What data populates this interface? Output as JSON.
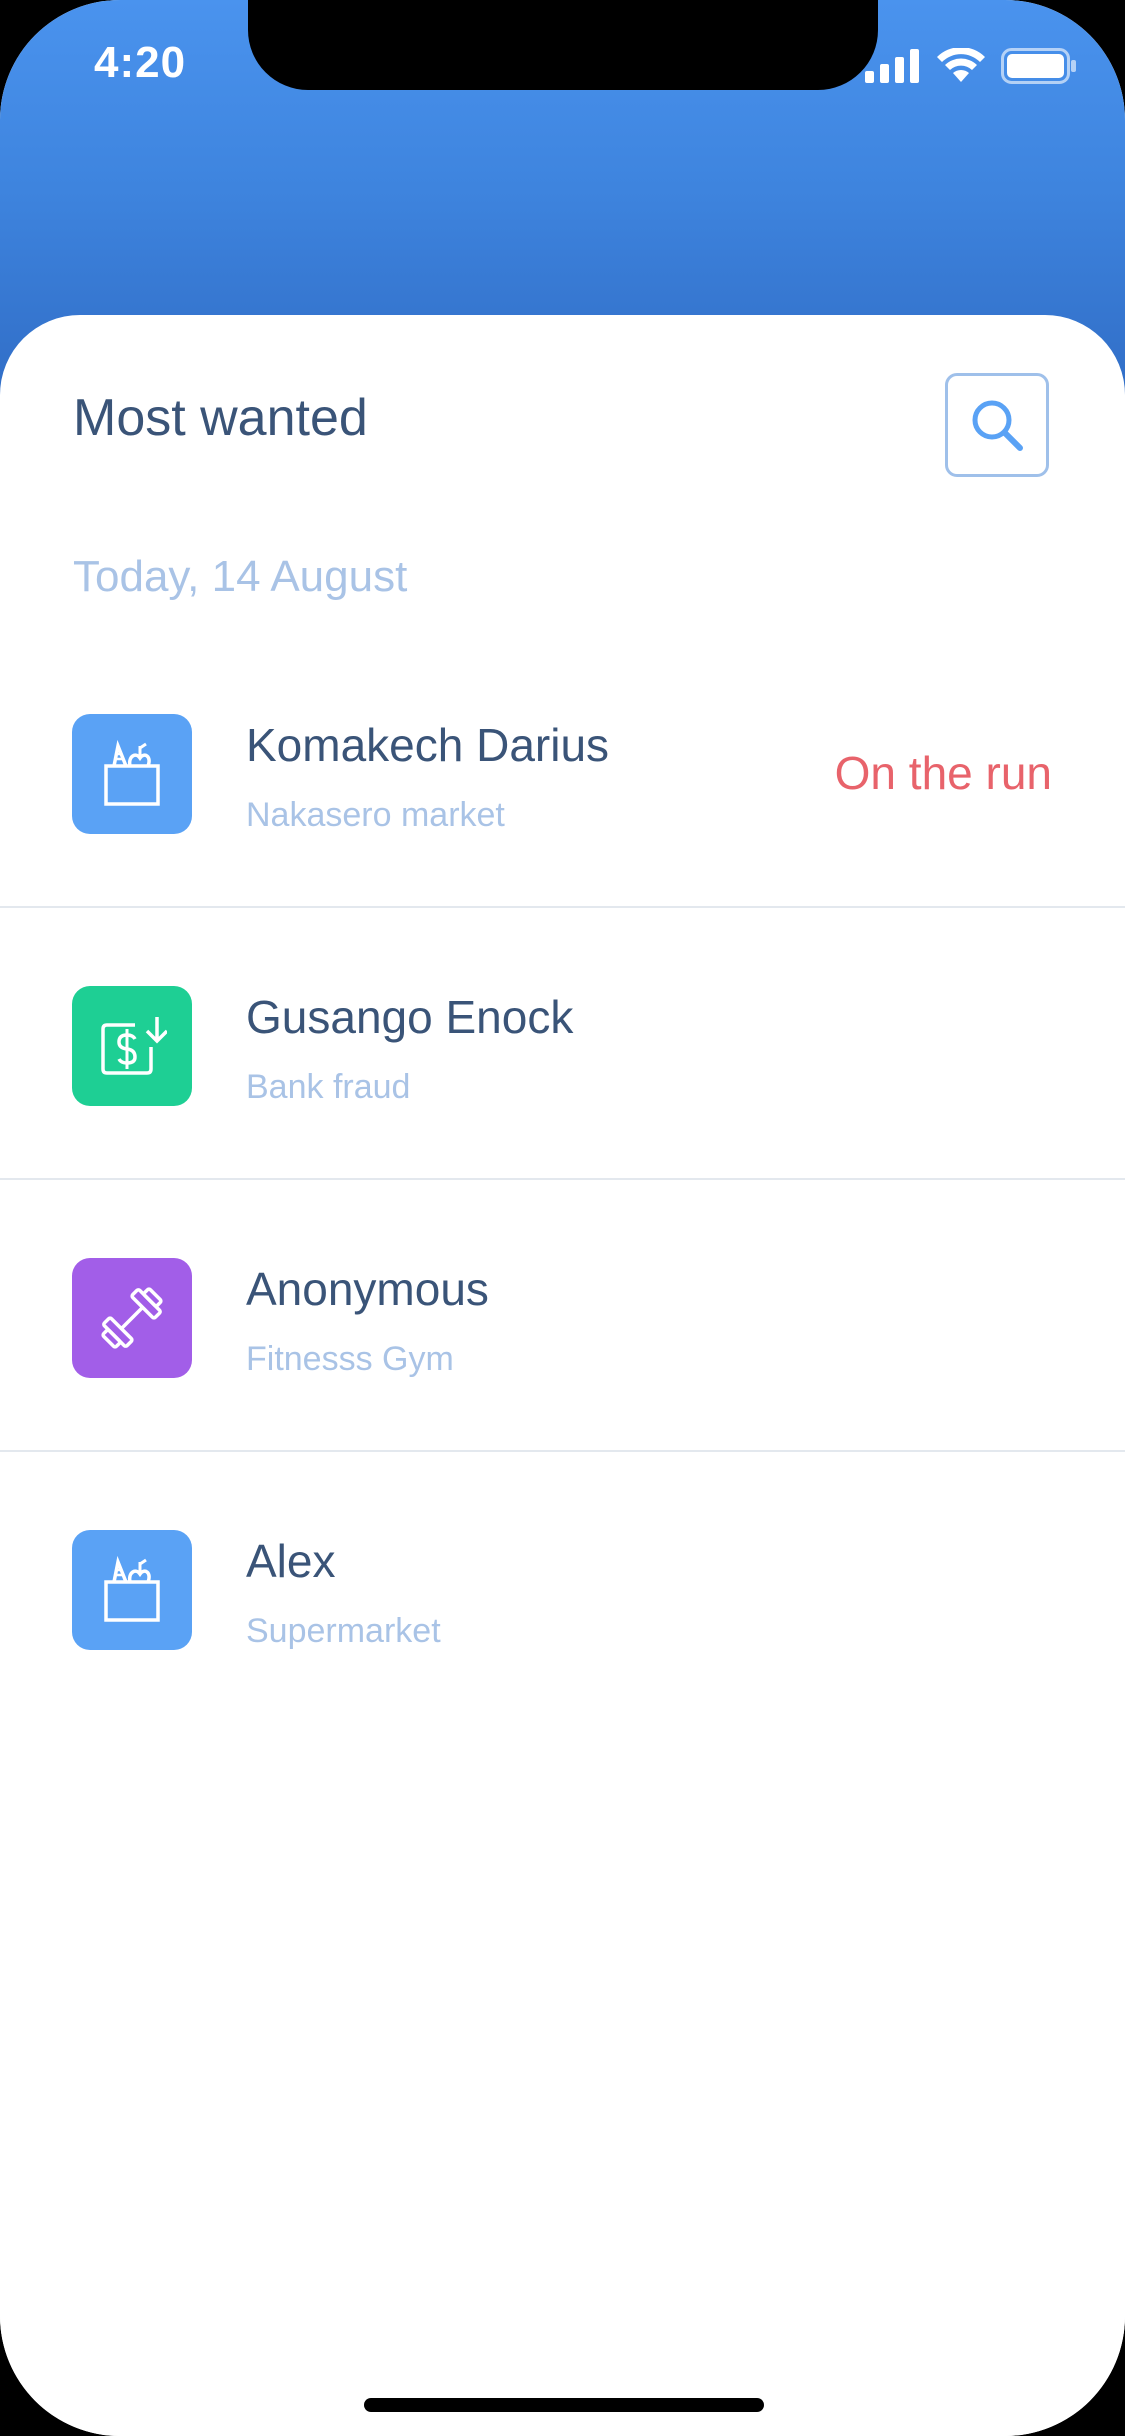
{
  "status_bar": {
    "time": "4:20",
    "signal_icon": "cellular-signal-icon",
    "wifi_icon": "wifi-icon",
    "battery_icon": "battery-icon"
  },
  "header": {
    "title": "Most wanted",
    "search_icon": "search-icon"
  },
  "date_label": "Today, 14 August",
  "items": [
    {
      "name": "Komakech Darius",
      "location": "Nakasero market",
      "status": "On the run",
      "icon": "grocery-bag-icon",
      "icon_color": "#5aa2f5"
    },
    {
      "name": "Gusango Enock",
      "location": "Bank fraud",
      "status": "",
      "icon": "money-download-icon",
      "icon_color": "#1ecf94"
    },
    {
      "name": "Anonymous",
      "location": "Fitnesss Gym",
      "status": "",
      "icon": "dumbbell-icon",
      "icon_color": "#a25ee8"
    },
    {
      "name": "Alex",
      "location": "Supermarket",
      "status": "",
      "icon": "grocery-bag-icon",
      "icon_color": "#5aa2f5"
    }
  ],
  "colors": {
    "header_gradient_top": "#4a93ee",
    "header_gradient_bottom": "#2f6bc4",
    "title_text": "#3a5478",
    "secondary_text": "#a9c3e6",
    "status_alert": "#e8636b"
  }
}
